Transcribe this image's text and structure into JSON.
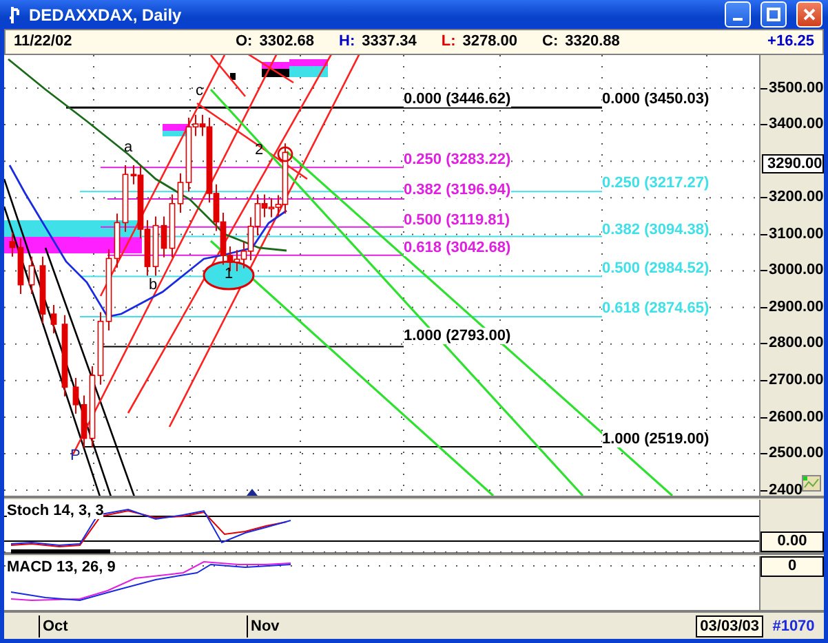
{
  "window": {
    "title": "DEDAXXDAX, Daily"
  },
  "quote_bar": {
    "date": "11/22/02",
    "quotes": [
      {
        "label": "O:",
        "value": "3302.68",
        "color": "#000000"
      },
      {
        "label": "H:",
        "value": "3337.34",
        "color": "#0000cc"
      },
      {
        "label": "L:",
        "value": "3278.00",
        "color": "#e00000"
      },
      {
        "label": "C:",
        "value": "3320.88",
        "color": "#000000"
      }
    ],
    "change": "+16.25"
  },
  "chart": {
    "price_labels": [
      "3500.00",
      "3400.00",
      "3200.00",
      "3100.00",
      "3000.00",
      "2900.00",
      "2800.00",
      "2700.00",
      "2600.00",
      "2500.00",
      "2400"
    ],
    "current_price": "3290.00",
    "fib_levels": [
      {
        "label": "0.000 (3446.62)",
        "color": "#000000"
      },
      {
        "label": "0.250 (3283.22)",
        "color": "#e020e0"
      },
      {
        "label": "0.382 (3196.94)",
        "color": "#e020e0"
      },
      {
        "label": "0.500 (3119.81)",
        "color": "#e020e0"
      },
      {
        "label": "0.618 (3042.68)",
        "color": "#e020e0"
      },
      {
        "label": "1.000 (2793.00)",
        "color": "#000000"
      },
      {
        "label": "0.000 (3450.03)",
        "color": "#000000"
      },
      {
        "label": "0.250 (3217.27)",
        "color": "#40e0e8"
      },
      {
        "label": "0.382 (3094.38)",
        "color": "#40e0e8"
      },
      {
        "label": "0.500 (2984.52)",
        "color": "#40e0e8"
      },
      {
        "label": "0.618 (2874.65)",
        "color": "#40e0e8"
      },
      {
        "label": "1.000 (2519.00)",
        "color": "#000000"
      }
    ],
    "wave_labels": [
      "c",
      "a",
      "2",
      "1",
      "b",
      "P"
    ]
  },
  "panels": [
    {
      "kind": "stochastic",
      "label": "Stoch 14, 3, 3",
      "scale_value": "0.00"
    },
    {
      "kind": "macd",
      "label": "MACD 13, 26, 9",
      "scale_value": "0"
    }
  ],
  "date_axis": {
    "months": [
      "Oct",
      "Nov"
    ],
    "end_date": "03/03/03",
    "bar_count": "#1070"
  }
}
